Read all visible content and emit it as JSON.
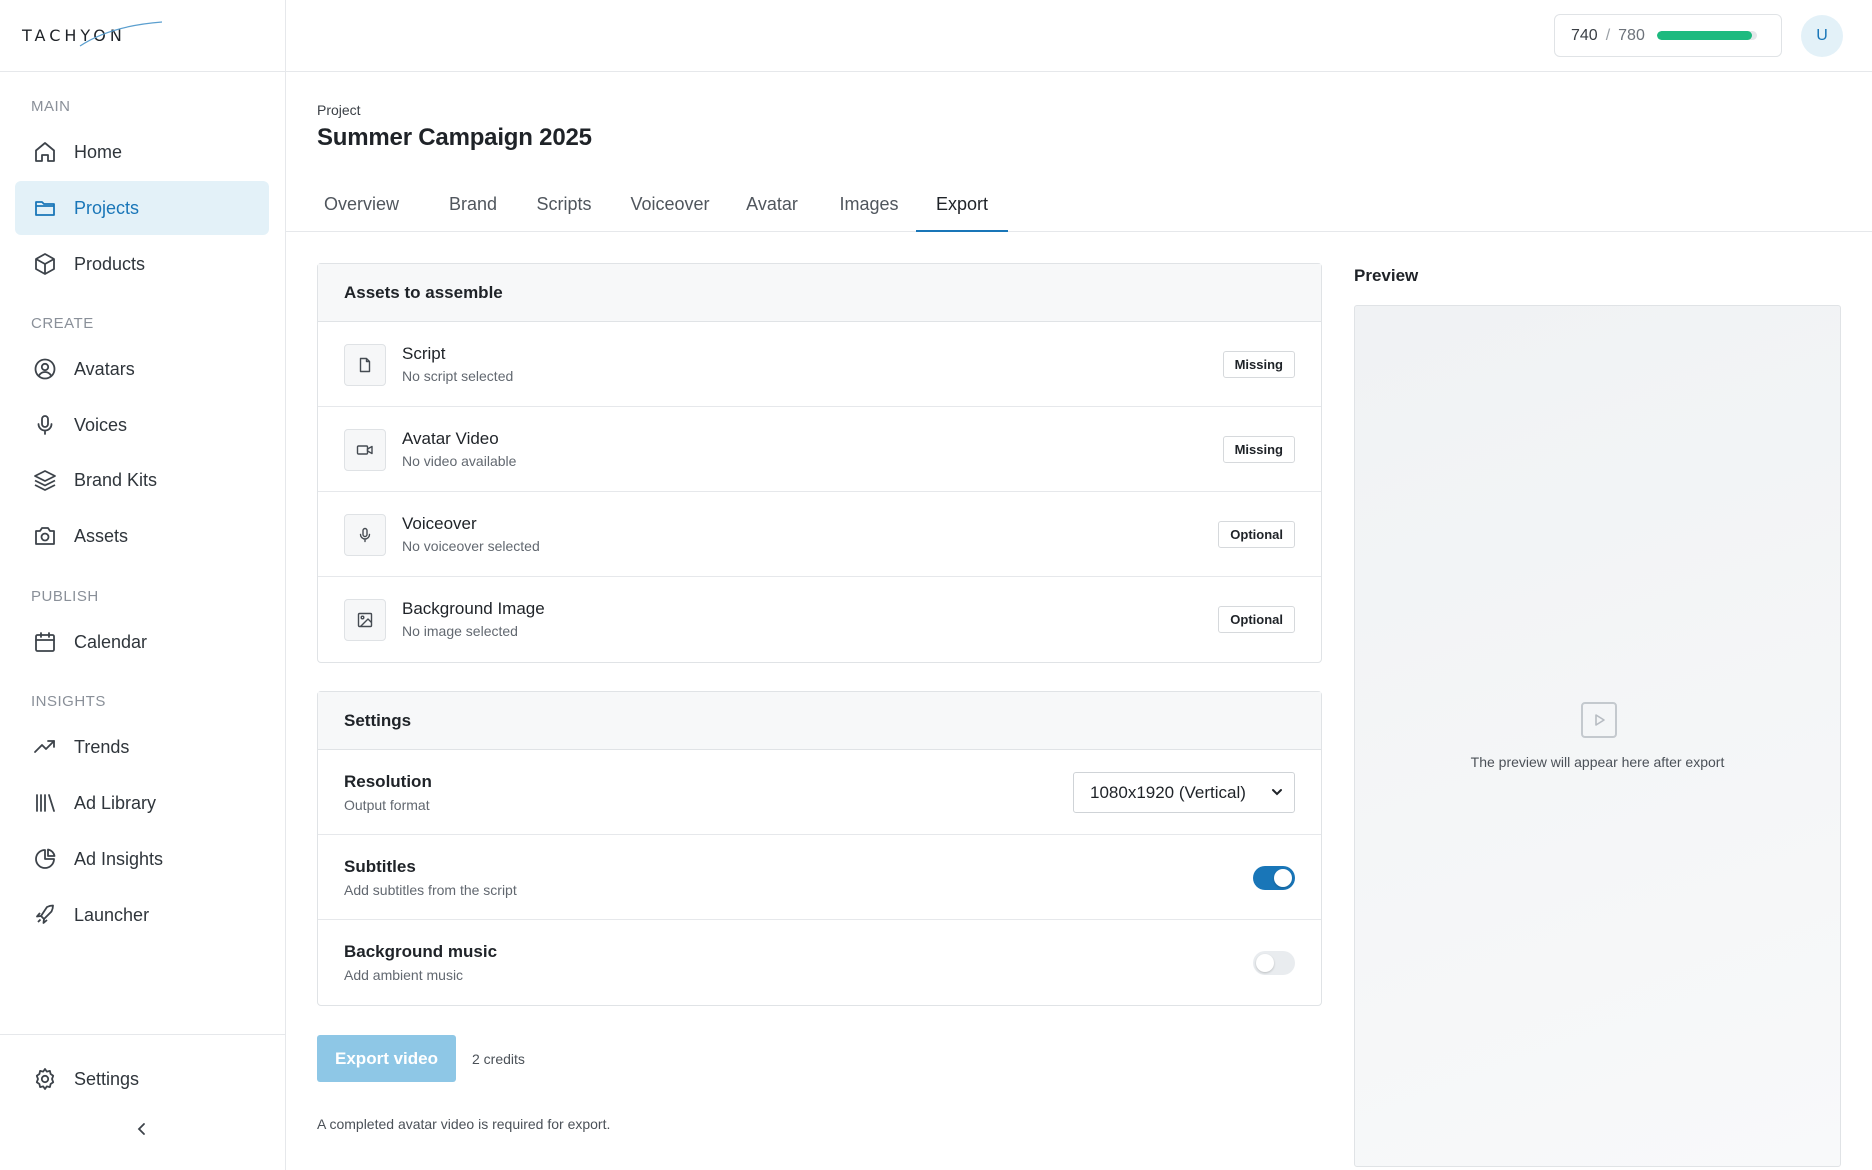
{
  "app": {
    "logo_text": "TACHYON"
  },
  "sidebar": {
    "sections": [
      {
        "label": "MAIN"
      },
      {
        "label": "CREATE"
      },
      {
        "label": "PUBLISH"
      },
      {
        "label": "INSIGHTS"
      }
    ],
    "items": [
      {
        "label": "Home",
        "icon": "home-icon"
      },
      {
        "label": "Projects",
        "icon": "folder-icon",
        "active": true
      },
      {
        "label": "Products",
        "icon": "box-icon"
      },
      {
        "label": "Avatars",
        "icon": "user-circle-icon"
      },
      {
        "label": "Voices",
        "icon": "microphone-icon"
      },
      {
        "label": "Brand Kits",
        "icon": "layers-icon"
      },
      {
        "label": "Assets",
        "icon": "camera-icon"
      },
      {
        "label": "Calendar",
        "icon": "calendar-icon"
      },
      {
        "label": "Trends",
        "icon": "trending-up-icon"
      },
      {
        "label": "Ad Library",
        "icon": "library-icon"
      },
      {
        "label": "Ad Insights",
        "icon": "pie-chart-icon"
      },
      {
        "label": "Launcher",
        "icon": "rocket-icon"
      }
    ],
    "settings_label": "Settings",
    "collapse_icon": "chevron-left-icon"
  },
  "header": {
    "credits_used": "740",
    "credits_sep": "/",
    "credits_total": "780",
    "credits_fraction": 0.9487,
    "avatar_initial": "U"
  },
  "page": {
    "eyebrow": "Project",
    "title": "Summer Campaign 2025",
    "tabs": [
      "Overview",
      "Brand",
      "Scripts",
      "Voiceover",
      "Avatar",
      "Images",
      "Export"
    ],
    "active_tab": "Export"
  },
  "assets": {
    "heading": "Assets to assemble",
    "rows": [
      {
        "title": "Script",
        "subtitle": "No script selected",
        "badge": "Missing",
        "icon": "file-icon"
      },
      {
        "title": "Avatar Video",
        "subtitle": "No video available",
        "badge": "Missing",
        "icon": "video-icon"
      },
      {
        "title": "Voiceover",
        "subtitle": "No voiceover selected",
        "badge": "Optional",
        "icon": "microphone-icon"
      },
      {
        "title": "Background Image",
        "subtitle": "No image selected",
        "badge": "Optional",
        "icon": "image-icon"
      }
    ]
  },
  "settings": {
    "heading": "Settings",
    "resolution": {
      "title": "Resolution",
      "subtitle": "Output format",
      "value": "1080x1920 (Vertical)"
    },
    "subtitles": {
      "title": "Subtitles",
      "subtitle": "Add subtitles from the script",
      "enabled": true
    },
    "music": {
      "title": "Background music",
      "subtitle": "Add ambient music",
      "enabled": false
    }
  },
  "export": {
    "button_label": "Export video",
    "cost": "2 credits",
    "note": "A completed avatar video is required for export."
  },
  "preview": {
    "label": "Preview",
    "placeholder": "The preview will appear here after export"
  },
  "colors": {
    "accent": "#1976b8",
    "active_bg": "#e3f1f8",
    "progress": "#1dba7f",
    "export_disabled": "#8ec7e6"
  }
}
